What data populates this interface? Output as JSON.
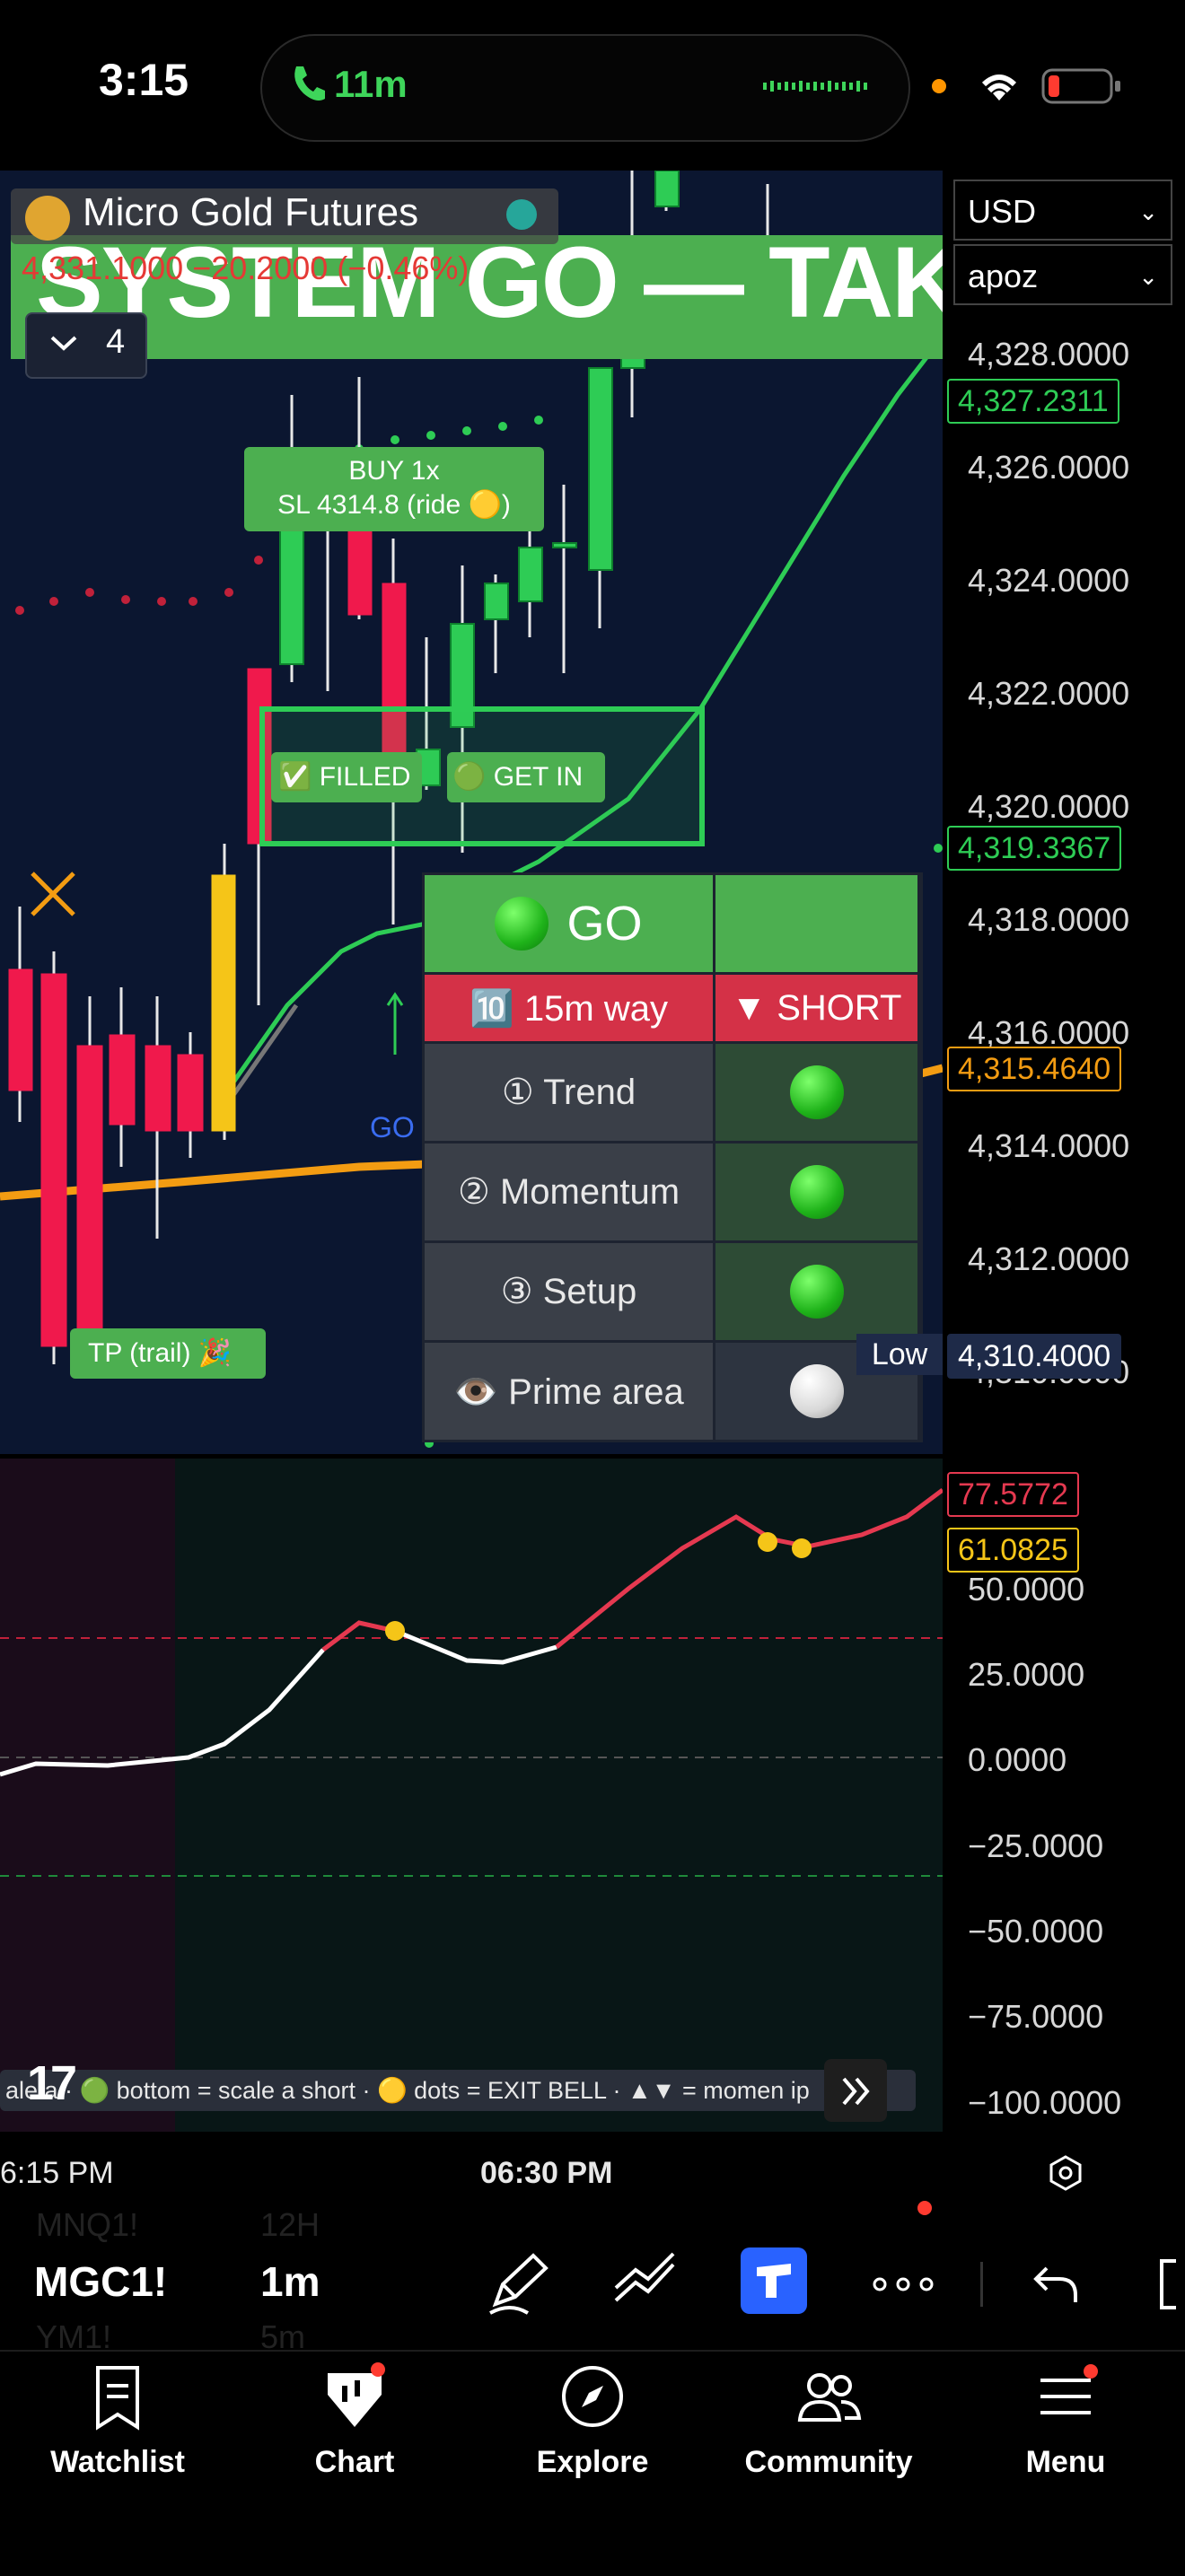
{
  "status_bar": {
    "time": "3:15",
    "call_duration": "11m"
  },
  "symbol_header": {
    "name": "Micro Gold Futures",
    "price_line": "4,331.1000 −20.2000 (−0.46%)",
    "banner": "SYSTEM GO — TAKE",
    "collapse_count": "4"
  },
  "selectors": {
    "currency": "USD",
    "profile": "apoz"
  },
  "price_axis": {
    "ticks": [
      "4,328.0000",
      "4,326.0000",
      "4,324.0000",
      "4,322.0000",
      "4,320.0000",
      "4,318.0000",
      "4,316.0000",
      "4,314.0000",
      "4,312.0000",
      "4,310.0000"
    ],
    "labels": [
      {
        "value": "4,327.2311",
        "color": "#2ecc55"
      },
      {
        "value": "4,319.3367",
        "color": "#2ecc55"
      },
      {
        "value": "4,315.4640",
        "color": "#f39c12"
      },
      {
        "value": "4,310.4000",
        "color": "#ffffff",
        "tag": "Low"
      }
    ]
  },
  "oscillator_axis": {
    "ticks": [
      "50.0000",
      "25.0000",
      "0.0000",
      "−25.0000",
      "−50.0000",
      "−75.0000",
      "−100.0000"
    ],
    "labels": [
      {
        "value": "77.5772",
        "color": "#e53950"
      },
      {
        "value": "61.0825",
        "color": "#f5c518"
      }
    ]
  },
  "chart_annotations": {
    "buy_tag_line1": "BUY 1x",
    "buy_tag_line2": "SL 4314.8 (ride 🟡)",
    "filled_tag": "✅ FILLED",
    "get_in_tag": "🟢 GET IN",
    "tp_tag": "TP (trail) 🎉",
    "go_text": "GO",
    "ticker_tape": "ale a · 🟢 bottom = scale a short · 🟡 dots = EXIT BELL · ▲▼ = momen    ip"
  },
  "signal_table": {
    "header": "GO",
    "mode_label": "🔟 15m way",
    "direction": "▼ SHORT",
    "rows": [
      {
        "label": "① Trend",
        "state": "green"
      },
      {
        "label": "② Momentum",
        "state": "green"
      },
      {
        "label": "③ Setup",
        "state": "green"
      },
      {
        "label": "👁️ Prime area",
        "state": "white"
      }
    ]
  },
  "time_axis": {
    "left": "6:15 PM",
    "center": "06:30 PM"
  },
  "toolbar": {
    "symbol": "MGC1!",
    "symbol_above": "MNQ1!",
    "symbol_below": "YM1!",
    "interval": "1m",
    "interval_above": "12H",
    "interval_below": "5m"
  },
  "tabs": [
    {
      "label": "Watchlist",
      "icon": "watchlist-icon"
    },
    {
      "label": "Chart",
      "icon": "chart-icon"
    },
    {
      "label": "Explore",
      "icon": "compass-icon"
    },
    {
      "label": "Community",
      "icon": "community-icon"
    },
    {
      "label": "Menu",
      "icon": "menu-icon"
    }
  ],
  "colors": {
    "bull": "#2ecc55",
    "bear": "#f0194c",
    "signal": "#f5c518",
    "ema": "#f39c12",
    "accent": "#4caf50"
  }
}
